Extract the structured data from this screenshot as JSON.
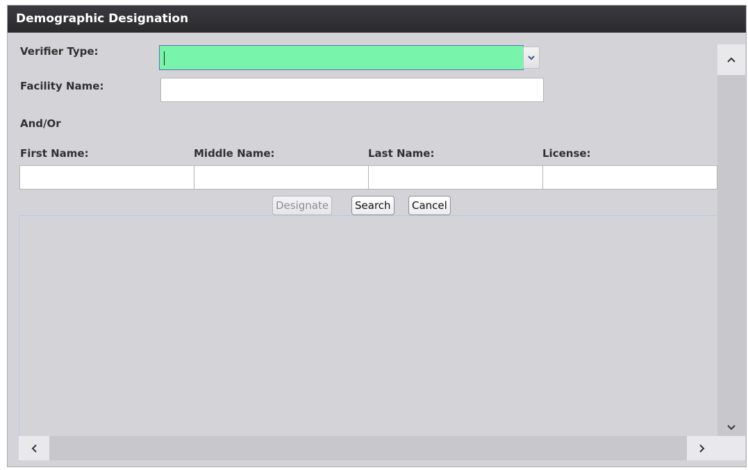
{
  "dialog": {
    "title": "Demographic Designation"
  },
  "form": {
    "verifier_type_label": "Verifier Type:",
    "verifier_type_value": "",
    "facility_name_label": "Facility Name:",
    "facility_name_value": "",
    "and_or_label": "And/Or",
    "first_name_label": "First Name:",
    "middle_name_label": "Middle Name:",
    "last_name_label": "Last Name:",
    "license_label": "License:",
    "first_name_value": "",
    "middle_name_value": "",
    "last_name_value": "",
    "license_value": ""
  },
  "buttons": {
    "designate": "Designate",
    "search": "Search",
    "cancel": "Cancel"
  },
  "colors": {
    "title_bar": "#2f2f33",
    "dialog_bg": "#d4d3d8",
    "select_highlight": "#78f5aa"
  },
  "icons": {
    "select_dropdown": "chevron-down-icon",
    "scroll_up": "chevron-up-icon",
    "scroll_down": "chevron-down-icon",
    "scroll_left": "chevron-left-icon",
    "scroll_right": "chevron-right-icon"
  }
}
